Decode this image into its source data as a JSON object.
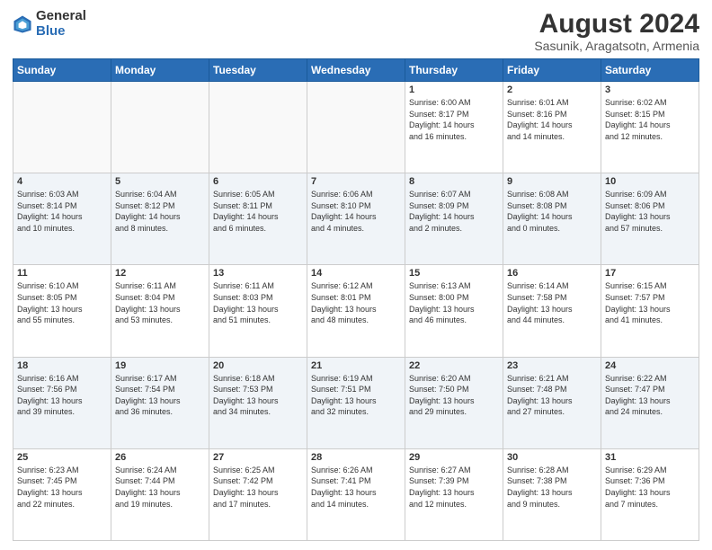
{
  "logo": {
    "general": "General",
    "blue": "Blue"
  },
  "title": "August 2024",
  "subtitle": "Sasunik, Aragatsotn, Armenia",
  "weekdays": [
    "Sunday",
    "Monday",
    "Tuesday",
    "Wednesday",
    "Thursday",
    "Friday",
    "Saturday"
  ],
  "weeks": [
    [
      {
        "day": "",
        "info": ""
      },
      {
        "day": "",
        "info": ""
      },
      {
        "day": "",
        "info": ""
      },
      {
        "day": "",
        "info": ""
      },
      {
        "day": "1",
        "info": "Sunrise: 6:00 AM\nSunset: 8:17 PM\nDaylight: 14 hours\nand 16 minutes."
      },
      {
        "day": "2",
        "info": "Sunrise: 6:01 AM\nSunset: 8:16 PM\nDaylight: 14 hours\nand 14 minutes."
      },
      {
        "day": "3",
        "info": "Sunrise: 6:02 AM\nSunset: 8:15 PM\nDaylight: 14 hours\nand 12 minutes."
      }
    ],
    [
      {
        "day": "4",
        "info": "Sunrise: 6:03 AM\nSunset: 8:14 PM\nDaylight: 14 hours\nand 10 minutes."
      },
      {
        "day": "5",
        "info": "Sunrise: 6:04 AM\nSunset: 8:12 PM\nDaylight: 14 hours\nand 8 minutes."
      },
      {
        "day": "6",
        "info": "Sunrise: 6:05 AM\nSunset: 8:11 PM\nDaylight: 14 hours\nand 6 minutes."
      },
      {
        "day": "7",
        "info": "Sunrise: 6:06 AM\nSunset: 8:10 PM\nDaylight: 14 hours\nand 4 minutes."
      },
      {
        "day": "8",
        "info": "Sunrise: 6:07 AM\nSunset: 8:09 PM\nDaylight: 14 hours\nand 2 minutes."
      },
      {
        "day": "9",
        "info": "Sunrise: 6:08 AM\nSunset: 8:08 PM\nDaylight: 14 hours\nand 0 minutes."
      },
      {
        "day": "10",
        "info": "Sunrise: 6:09 AM\nSunset: 8:06 PM\nDaylight: 13 hours\nand 57 minutes."
      }
    ],
    [
      {
        "day": "11",
        "info": "Sunrise: 6:10 AM\nSunset: 8:05 PM\nDaylight: 13 hours\nand 55 minutes."
      },
      {
        "day": "12",
        "info": "Sunrise: 6:11 AM\nSunset: 8:04 PM\nDaylight: 13 hours\nand 53 minutes."
      },
      {
        "day": "13",
        "info": "Sunrise: 6:11 AM\nSunset: 8:03 PM\nDaylight: 13 hours\nand 51 minutes."
      },
      {
        "day": "14",
        "info": "Sunrise: 6:12 AM\nSunset: 8:01 PM\nDaylight: 13 hours\nand 48 minutes."
      },
      {
        "day": "15",
        "info": "Sunrise: 6:13 AM\nSunset: 8:00 PM\nDaylight: 13 hours\nand 46 minutes."
      },
      {
        "day": "16",
        "info": "Sunrise: 6:14 AM\nSunset: 7:58 PM\nDaylight: 13 hours\nand 44 minutes."
      },
      {
        "day": "17",
        "info": "Sunrise: 6:15 AM\nSunset: 7:57 PM\nDaylight: 13 hours\nand 41 minutes."
      }
    ],
    [
      {
        "day": "18",
        "info": "Sunrise: 6:16 AM\nSunset: 7:56 PM\nDaylight: 13 hours\nand 39 minutes."
      },
      {
        "day": "19",
        "info": "Sunrise: 6:17 AM\nSunset: 7:54 PM\nDaylight: 13 hours\nand 36 minutes."
      },
      {
        "day": "20",
        "info": "Sunrise: 6:18 AM\nSunset: 7:53 PM\nDaylight: 13 hours\nand 34 minutes."
      },
      {
        "day": "21",
        "info": "Sunrise: 6:19 AM\nSunset: 7:51 PM\nDaylight: 13 hours\nand 32 minutes."
      },
      {
        "day": "22",
        "info": "Sunrise: 6:20 AM\nSunset: 7:50 PM\nDaylight: 13 hours\nand 29 minutes."
      },
      {
        "day": "23",
        "info": "Sunrise: 6:21 AM\nSunset: 7:48 PM\nDaylight: 13 hours\nand 27 minutes."
      },
      {
        "day": "24",
        "info": "Sunrise: 6:22 AM\nSunset: 7:47 PM\nDaylight: 13 hours\nand 24 minutes."
      }
    ],
    [
      {
        "day": "25",
        "info": "Sunrise: 6:23 AM\nSunset: 7:45 PM\nDaylight: 13 hours\nand 22 minutes."
      },
      {
        "day": "26",
        "info": "Sunrise: 6:24 AM\nSunset: 7:44 PM\nDaylight: 13 hours\nand 19 minutes."
      },
      {
        "day": "27",
        "info": "Sunrise: 6:25 AM\nSunset: 7:42 PM\nDaylight: 13 hours\nand 17 minutes."
      },
      {
        "day": "28",
        "info": "Sunrise: 6:26 AM\nSunset: 7:41 PM\nDaylight: 13 hours\nand 14 minutes."
      },
      {
        "day": "29",
        "info": "Sunrise: 6:27 AM\nSunset: 7:39 PM\nDaylight: 13 hours\nand 12 minutes."
      },
      {
        "day": "30",
        "info": "Sunrise: 6:28 AM\nSunset: 7:38 PM\nDaylight: 13 hours\nand 9 minutes."
      },
      {
        "day": "31",
        "info": "Sunrise: 6:29 AM\nSunset: 7:36 PM\nDaylight: 13 hours\nand 7 minutes."
      }
    ]
  ]
}
